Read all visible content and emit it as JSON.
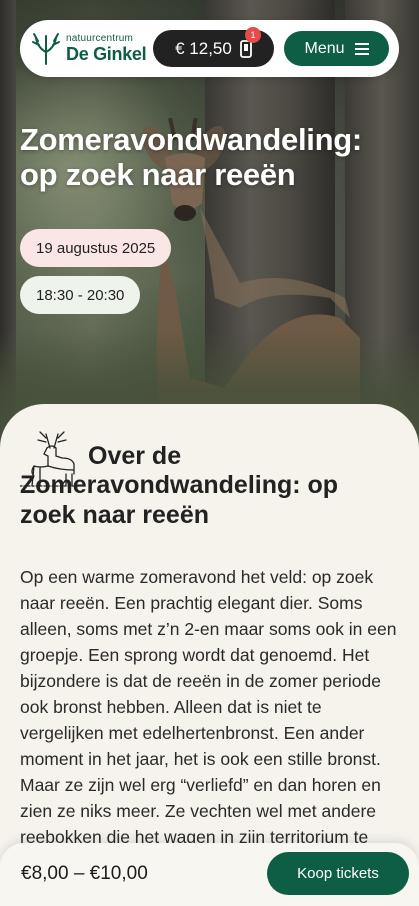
{
  "header": {
    "logo": {
      "line1": "natuurcentrum",
      "line2": "De Ginkel",
      "icon": "antler-logo-icon"
    },
    "cart": {
      "amount": "€ 12,50",
      "count": "1",
      "icon": "phone-cart-icon"
    },
    "menu": {
      "label": "Menu",
      "icon": "hamburger-icon"
    }
  },
  "hero": {
    "title": "Zomeravondwandeling: op zoek naar reeën",
    "date": "19 augustus 2025",
    "time": "18:30 - 20:30"
  },
  "about": {
    "icon": "reindeer-illustration-icon",
    "title": "Over de Zomeravondwandeling: op zoek naar reeën",
    "body": "Op een warme zomeravond het veld: op zoek naar reeën. Een prachtig elegant dier. Soms alleen, soms met z’n 2-en maar soms ook in een groepje. Een sprong wordt dat genoemd. Het bijzondere is dat de reeën in de zomer periode ook bronst hebben. Alleen dat is niet te vergelijken met edelhertenbronst. Een ander moment in het jaar, het is ook een stille bronst. Maar ze zijn wel erg “verliefd” en dan horen en zien ze niks meer. Ze vechten wel met andere reebokken die het wagen in zijn territorium te komen."
  },
  "footer": {
    "price": "€8,00 – €10,00",
    "buy_label": "Koop tickets"
  },
  "colors": {
    "brand_green": "#0d5e45",
    "badge_red": "#e64a4a",
    "date_pill": "#fbe6e6",
    "time_pill": "#eef3ec"
  }
}
